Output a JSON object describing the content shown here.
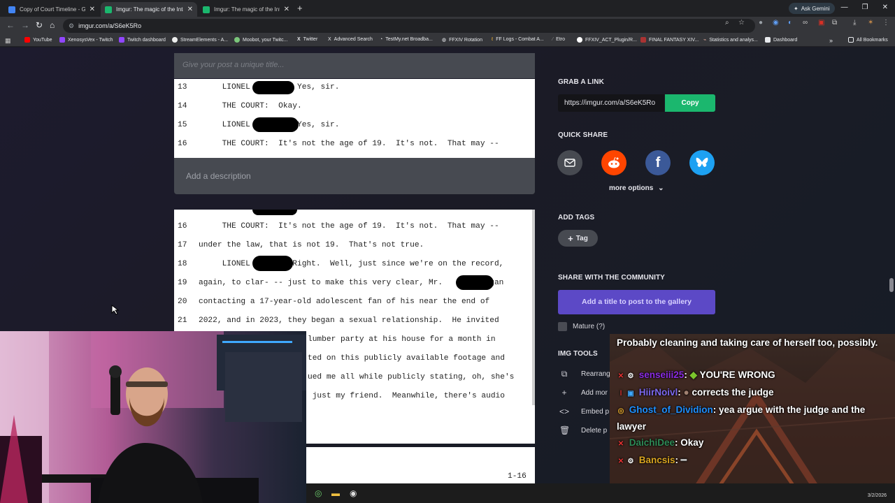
{
  "browser": {
    "tabs": [
      {
        "label": "Copy of Court Timeline - Goog",
        "active": false,
        "favicon_color": "#4285f4"
      },
      {
        "label": "Imgur: The magic of the Interne",
        "active": true,
        "favicon_color": "#1bb76e"
      },
      {
        "label": "Imgur: The magic of the Interne",
        "active": false,
        "favicon_color": "#1bb76e"
      }
    ],
    "new_tab": "+",
    "ask_gemini": "Ask Gemini",
    "url": "imgur.com/a/S6eK5Ro",
    "bookmarks": [
      {
        "label": "YouTube",
        "color": "#ff0000"
      },
      {
        "label": "XenosysVex - Twitch",
        "color": "#9146ff"
      },
      {
        "label": "Twitch dashboard",
        "color": "#9146ff"
      },
      {
        "label": "StreamElements - A...",
        "color": "#eeeeee"
      },
      {
        "label": "Moobot, your Twitc...",
        "color": "#7bc67b"
      },
      {
        "label": "Twitter",
        "color": "#e8eaed"
      },
      {
        "label": "Advanced Search",
        "color": "#e8eaed"
      },
      {
        "label": "TestMy.net Broadba...",
        "color": "#cccccc"
      },
      {
        "label": "FFXIV Rotation",
        "color": "#ffffff"
      },
      {
        "label": "FF Logs - Combat A...",
        "color": "#f0b030"
      },
      {
        "label": "Etro",
        "color": "#888888"
      },
      {
        "label": "FFXIV_ACT_Plugin/R...",
        "color": "#ffffff"
      },
      {
        "label": "FINAL FANTASY XIV...",
        "color": "#a33"
      },
      {
        "label": "Statistics and analys...",
        "color": "#e8b0a0"
      },
      {
        "label": "Dashboard",
        "color": "#e8eaed"
      }
    ],
    "all_bookmarks": "All Bookmarks"
  },
  "post": {
    "title_placeholder": "Give your post a unique title...",
    "description_placeholder": "Add a description",
    "image1_lines": [
      {
        "num": "13",
        "text": "     LIONEL          Yes, sir."
      },
      {
        "num": "14",
        "text": "     THE COURT:  Okay."
      },
      {
        "num": "15",
        "text": "     LIONEL          Yes, sir."
      },
      {
        "num": "16",
        "text": "     THE COURT:  It's not the age of 19.  It's not.  That may --"
      }
    ],
    "image2_lines": [
      {
        "num": "16",
        "text": "     THE COURT:  It's not the age of 19.  It's not.  That may --"
      },
      {
        "num": "17",
        "text": "under the law, that is not 19.  That's not true."
      },
      {
        "num": "18",
        "text": "     LIONEL         Right.  Well, just since we're on the record,"
      },
      {
        "num": "19",
        "text": "again, to clar- -- just to make this very clear, Mr.        began"
      },
      {
        "num": "20",
        "text": "contacting a 17-year-old adolescent fan of his near the end of"
      },
      {
        "num": "21",
        "text": "2022, and in 2023, they began a sexual relationship.  He invited"
      },
      {
        "num": "",
        "text": "lumber party at his house for a month in"
      },
      {
        "num": "",
        "text": "ted on this publicly available footage and"
      },
      {
        "num": "",
        "text": "ued me all while publicly stating, oh, she's"
      },
      {
        "num": "",
        "text": " just my friend.  Meanwhile, there's audio"
      }
    ],
    "page_footer": "1-16"
  },
  "panel": {
    "grab_link_heading": "GRAB A LINK",
    "link_value": "https://imgur.com/a/S6eK5Ro",
    "copy_label": "Copy",
    "quick_share_heading": "QUICK SHARE",
    "more_options": "more options",
    "add_tags_heading": "ADD TAGS",
    "tag_label": "Tag",
    "community_heading": "SHARE WITH THE COMMUNITY",
    "gallery_button": "Add a title to post to the gallery",
    "mature_label": "Mature (?)",
    "img_tools_heading": "IMG TOOLS",
    "tools": [
      "Rearrang",
      "Add mor",
      "Embed p",
      "Delete p"
    ]
  },
  "chat": {
    "messages": [
      {
        "user": "",
        "text": "Probably cleaning and taking care of herself too, possibly.",
        "color": "#ffffff"
      },
      {
        "user": "senseiii25",
        "text": "YOU'RE WRONG",
        "color": "#8a2be2"
      },
      {
        "user": "HiirNoivl",
        "text": "corrects the judge",
        "color": "#7b68ee"
      },
      {
        "user": "Ghost_of_Dividion",
        "text": "yea argue with the judge and the lawyer",
        "color": "#1e90ff"
      },
      {
        "user": "DaichiDee",
        "text": "Okay",
        "color": "#2e8b57"
      },
      {
        "user": "Bancsis",
        "text": "",
        "color": "#daa520"
      }
    ]
  },
  "taskbar": {
    "clock": "3/2/2026"
  }
}
